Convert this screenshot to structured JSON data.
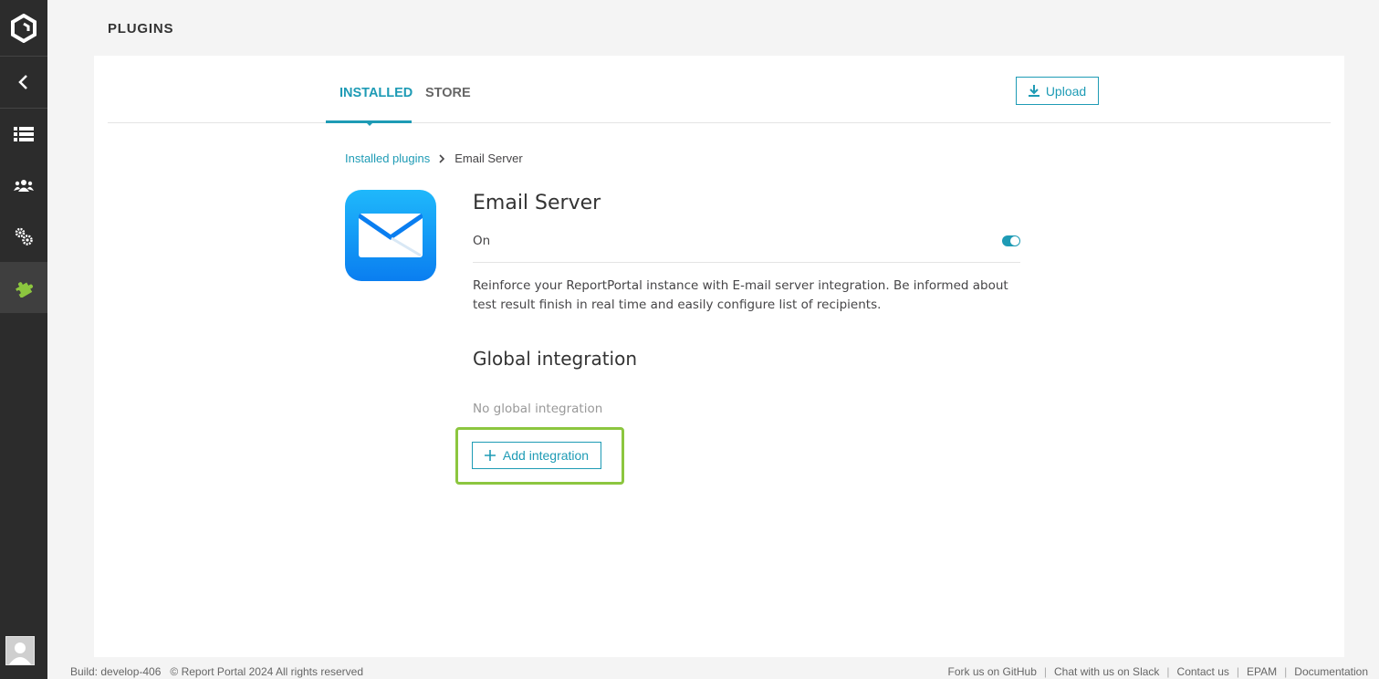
{
  "page": {
    "title": "PLUGINS"
  },
  "sidebar": {
    "items": [
      {
        "icon": "back-arrow-icon"
      },
      {
        "icon": "list-icon"
      },
      {
        "icon": "users-icon"
      },
      {
        "icon": "gears-icon"
      },
      {
        "icon": "puzzle-icon",
        "active": true
      }
    ]
  },
  "tabs": [
    {
      "label": "INSTALLED",
      "active": true
    },
    {
      "label": "STORE",
      "active": false
    }
  ],
  "toolbar": {
    "upload_label": "Upload"
  },
  "breadcrumb": {
    "link": "Installed plugins",
    "current": "Email Server"
  },
  "plugin": {
    "name": "Email Server",
    "status": "On",
    "enabled": true,
    "description": "Reinforce your ReportPortal instance with E-mail server integration. Be informed about test result finish in real time and easily configure list of recipients."
  },
  "global_integration": {
    "title": "Global integration",
    "empty_text": "No global integration",
    "add_label": "Add integration"
  },
  "footer": {
    "build": "Build: develop-406",
    "copyright": "© Report Portal 2024 All rights reserved",
    "links": [
      "Fork us on GitHub",
      "Chat with us on Slack",
      "Contact us",
      "EPAM",
      "Documentation"
    ]
  },
  "colors": {
    "accent": "#1e9bb5",
    "highlight": "#8cc63f",
    "sidebar": "#2c2c2c",
    "active_plugin_icon": "#8cc63f"
  }
}
